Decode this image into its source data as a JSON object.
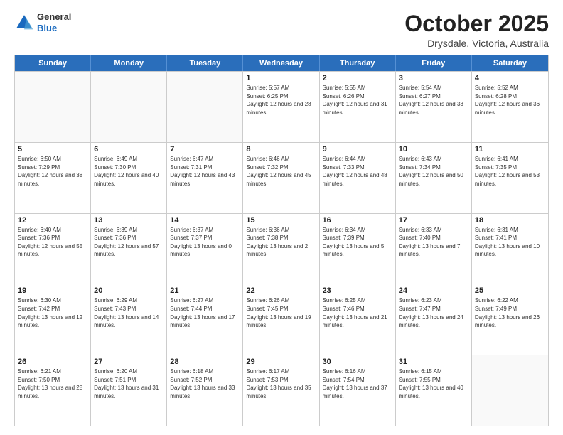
{
  "header": {
    "logo_general": "General",
    "logo_blue": "Blue",
    "month": "October 2025",
    "location": "Drysdale, Victoria, Australia"
  },
  "weekdays": [
    "Sunday",
    "Monday",
    "Tuesday",
    "Wednesday",
    "Thursday",
    "Friday",
    "Saturday"
  ],
  "weeks": [
    [
      {
        "day": "",
        "empty": true
      },
      {
        "day": "",
        "empty": true
      },
      {
        "day": "",
        "empty": true
      },
      {
        "day": "1",
        "rise": "5:57 AM",
        "set": "6:25 PM",
        "daylight": "12 hours and 28 minutes."
      },
      {
        "day": "2",
        "rise": "5:55 AM",
        "set": "6:26 PM",
        "daylight": "12 hours and 31 minutes."
      },
      {
        "day": "3",
        "rise": "5:54 AM",
        "set": "6:27 PM",
        "daylight": "12 hours and 33 minutes."
      },
      {
        "day": "4",
        "rise": "5:52 AM",
        "set": "6:28 PM",
        "daylight": "12 hours and 36 minutes."
      }
    ],
    [
      {
        "day": "5",
        "rise": "6:50 AM",
        "set": "7:29 PM",
        "daylight": "12 hours and 38 minutes."
      },
      {
        "day": "6",
        "rise": "6:49 AM",
        "set": "7:30 PM",
        "daylight": "12 hours and 40 minutes."
      },
      {
        "day": "7",
        "rise": "6:47 AM",
        "set": "7:31 PM",
        "daylight": "12 hours and 43 minutes."
      },
      {
        "day": "8",
        "rise": "6:46 AM",
        "set": "7:32 PM",
        "daylight": "12 hours and 45 minutes."
      },
      {
        "day": "9",
        "rise": "6:44 AM",
        "set": "7:33 PM",
        "daylight": "12 hours and 48 minutes."
      },
      {
        "day": "10",
        "rise": "6:43 AM",
        "set": "7:34 PM",
        "daylight": "12 hours and 50 minutes."
      },
      {
        "day": "11",
        "rise": "6:41 AM",
        "set": "7:35 PM",
        "daylight": "12 hours and 53 minutes."
      }
    ],
    [
      {
        "day": "12",
        "rise": "6:40 AM",
        "set": "7:36 PM",
        "daylight": "12 hours and 55 minutes."
      },
      {
        "day": "13",
        "rise": "6:39 AM",
        "set": "7:36 PM",
        "daylight": "12 hours and 57 minutes."
      },
      {
        "day": "14",
        "rise": "6:37 AM",
        "set": "7:37 PM",
        "daylight": "13 hours and 0 minutes."
      },
      {
        "day": "15",
        "rise": "6:36 AM",
        "set": "7:38 PM",
        "daylight": "13 hours and 2 minutes."
      },
      {
        "day": "16",
        "rise": "6:34 AM",
        "set": "7:39 PM",
        "daylight": "13 hours and 5 minutes."
      },
      {
        "day": "17",
        "rise": "6:33 AM",
        "set": "7:40 PM",
        "daylight": "13 hours and 7 minutes."
      },
      {
        "day": "18",
        "rise": "6:31 AM",
        "set": "7:41 PM",
        "daylight": "13 hours and 10 minutes."
      }
    ],
    [
      {
        "day": "19",
        "rise": "6:30 AM",
        "set": "7:42 PM",
        "daylight": "13 hours and 12 minutes."
      },
      {
        "day": "20",
        "rise": "6:29 AM",
        "set": "7:43 PM",
        "daylight": "13 hours and 14 minutes."
      },
      {
        "day": "21",
        "rise": "6:27 AM",
        "set": "7:44 PM",
        "daylight": "13 hours and 17 minutes."
      },
      {
        "day": "22",
        "rise": "6:26 AM",
        "set": "7:45 PM",
        "daylight": "13 hours and 19 minutes."
      },
      {
        "day": "23",
        "rise": "6:25 AM",
        "set": "7:46 PM",
        "daylight": "13 hours and 21 minutes."
      },
      {
        "day": "24",
        "rise": "6:23 AM",
        "set": "7:47 PM",
        "daylight": "13 hours and 24 minutes."
      },
      {
        "day": "25",
        "rise": "6:22 AM",
        "set": "7:49 PM",
        "daylight": "13 hours and 26 minutes."
      }
    ],
    [
      {
        "day": "26",
        "rise": "6:21 AM",
        "set": "7:50 PM",
        "daylight": "13 hours and 28 minutes."
      },
      {
        "day": "27",
        "rise": "6:20 AM",
        "set": "7:51 PM",
        "daylight": "13 hours and 31 minutes."
      },
      {
        "day": "28",
        "rise": "6:18 AM",
        "set": "7:52 PM",
        "daylight": "13 hours and 33 minutes."
      },
      {
        "day": "29",
        "rise": "6:17 AM",
        "set": "7:53 PM",
        "daylight": "13 hours and 35 minutes."
      },
      {
        "day": "30",
        "rise": "6:16 AM",
        "set": "7:54 PM",
        "daylight": "13 hours and 37 minutes."
      },
      {
        "day": "31",
        "rise": "6:15 AM",
        "set": "7:55 PM",
        "daylight": "13 hours and 40 minutes."
      },
      {
        "day": "",
        "empty": true
      }
    ]
  ]
}
